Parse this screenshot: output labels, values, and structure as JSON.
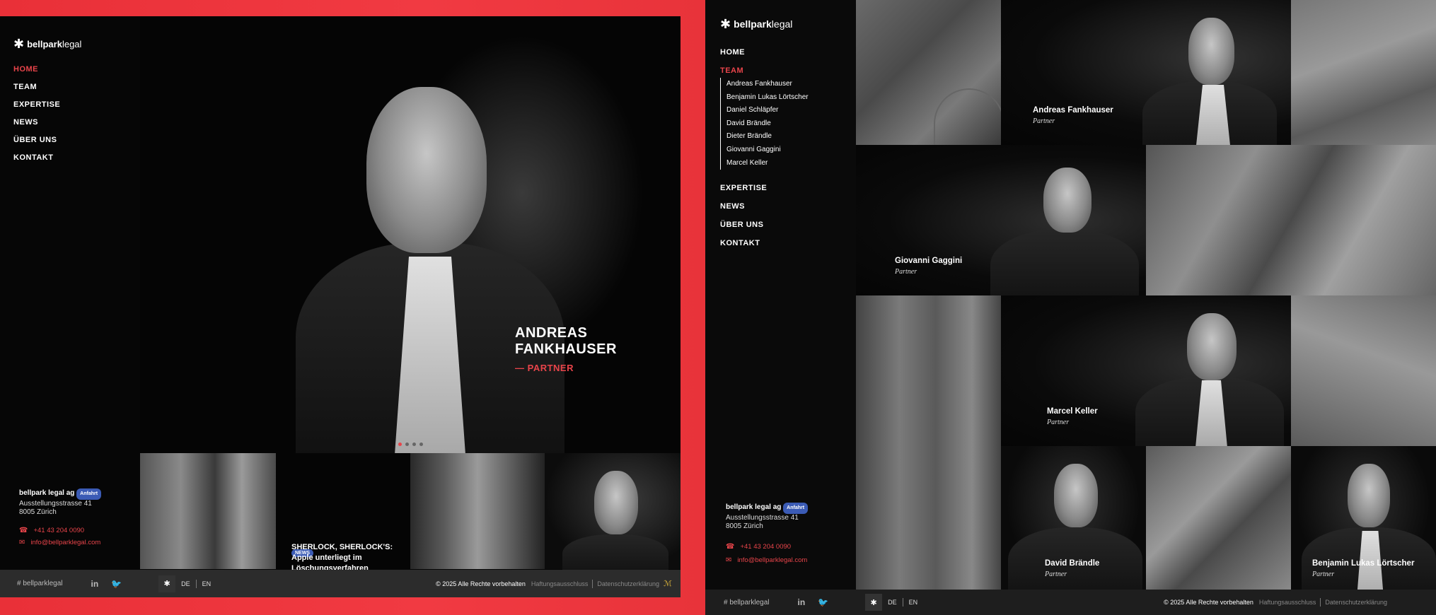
{
  "brand": {
    "mark": "✱",
    "name_bold": "bellpark",
    "name_light": "legal"
  },
  "left": {
    "nav": [
      "HOME",
      "TEAM",
      "EXPERTISE",
      "NEWS",
      "ÜBER UNS",
      "KONTAKT"
    ],
    "hero": {
      "name": "ANDREAS FANKHAUSER",
      "role": "— PARTNER"
    },
    "news": {
      "badge": "NEWS",
      "title": "SHERLOCK, SHERLOCK'S: Apple unterliegt im Löschungsverfahren"
    },
    "address": {
      "company": "bellpark legal ag",
      "badge": "Anfahrt",
      "street": "Ausstellungsstrasse 41",
      "city": "8005 Zürich"
    },
    "phone": "+41 43 204 0090",
    "email": "info@bellparklegal.com"
  },
  "right": {
    "nav_top": [
      "HOME",
      "TEAM"
    ],
    "team_members": [
      "Andreas Fankhauser",
      "Benjamin Lukas Lörtscher",
      "Daniel Schläpfer",
      "David Brändle",
      "Dieter Brändle",
      "Giovanni Gaggini",
      "Marcel Keller"
    ],
    "nav_bottom": [
      "EXPERTISE",
      "NEWS",
      "ÜBER UNS",
      "KONTAKT"
    ],
    "tiles": [
      {
        "name": "Andreas Fankhauser",
        "role": "Partner"
      },
      {
        "name": "Giovanni Gaggini",
        "role": "Partner"
      },
      {
        "name": "Marcel Keller",
        "role": "Partner"
      },
      {
        "name": "David Brändle",
        "role": "Partner"
      },
      {
        "name": "Benjamin Lukas Lörtscher",
        "role": "Partner"
      }
    ],
    "address": {
      "company": "bellpark legal ag",
      "badge": "Anfahrt",
      "street": "Ausstellungsstrasse 41",
      "city": "8005 Zürich"
    },
    "phone": "+41 43 204 0090",
    "email": "info@bellparklegal.com"
  },
  "footer": {
    "hashtag": "# bellparklegal",
    "linkedin": "in",
    "twitter": "🐦",
    "lang_icon": "✱",
    "lang_de": "DE",
    "lang_en": "EN",
    "copyright": "© 2025 Alle Rechte vorbehalten",
    "disclaimer": "Haftungsausschluss",
    "privacy": "Datenschutzerklärung",
    "signature": "ℳ"
  },
  "colors": {
    "accent": "#e8444a",
    "background": "#060606",
    "badge": "#3b5bb5"
  }
}
